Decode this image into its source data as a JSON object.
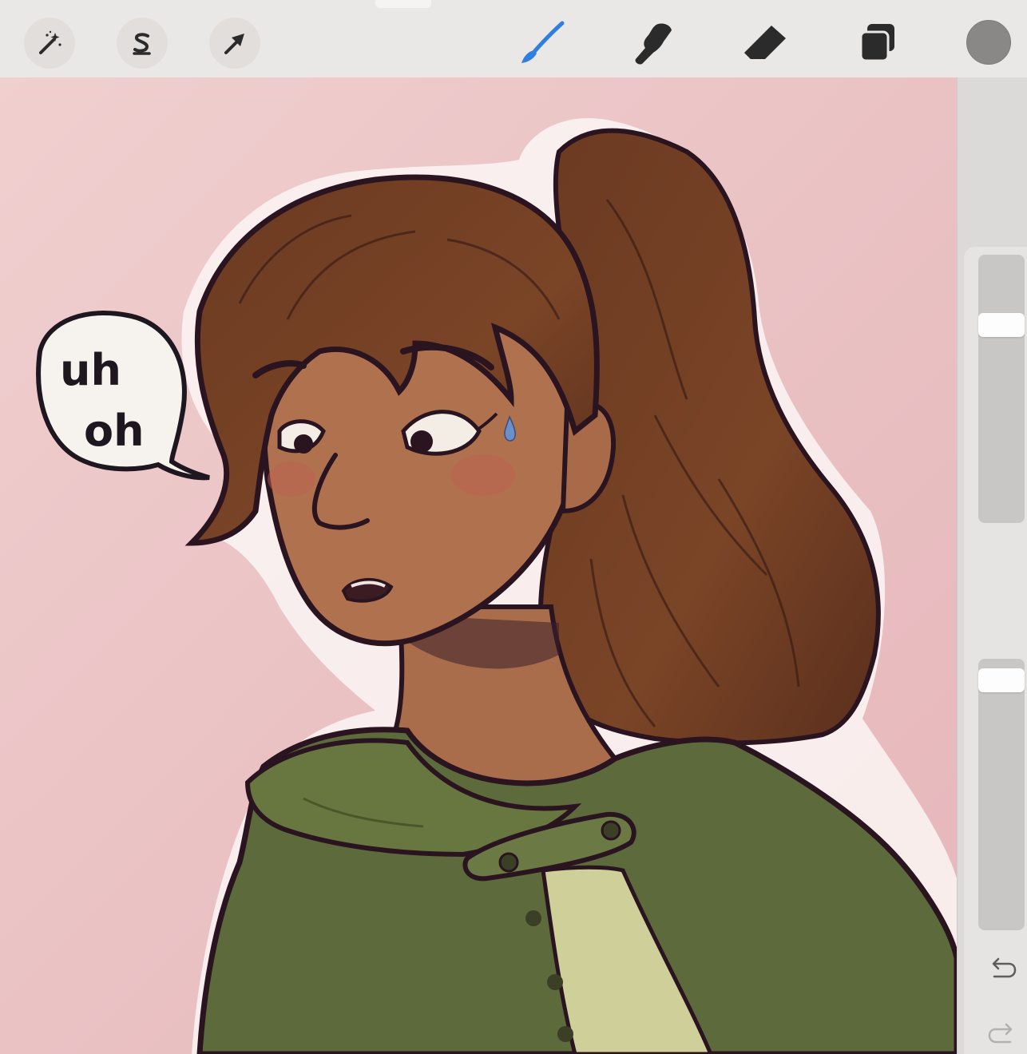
{
  "toolbar": {
    "left_tools": [
      {
        "name": "adjustments",
        "icon": "magic-wand-icon"
      },
      {
        "name": "selection",
        "icon": "selection-s-icon"
      },
      {
        "name": "transform",
        "icon": "arrow-cursor-icon"
      }
    ],
    "right_tools": [
      {
        "name": "brush",
        "icon": "brush-icon",
        "active": true,
        "color": "#2f7fe0"
      },
      {
        "name": "smudge",
        "icon": "smudge-hand-icon"
      },
      {
        "name": "eraser",
        "icon": "eraser-icon"
      },
      {
        "name": "layers",
        "icon": "layers-icon"
      }
    ],
    "current_color": "#8a8887"
  },
  "sidebar": {
    "brush_size_level": 0.76,
    "brush_opacity_level": 0.96,
    "modify_button_icon": "square-icon",
    "undo_icon": "undo-arrow-icon",
    "redo_icon": "redo-arrow-icon"
  },
  "canvas": {
    "speech_bubble_line1": "uh",
    "speech_bubble_line2": "oh",
    "background_color": "#ecc3c5"
  }
}
